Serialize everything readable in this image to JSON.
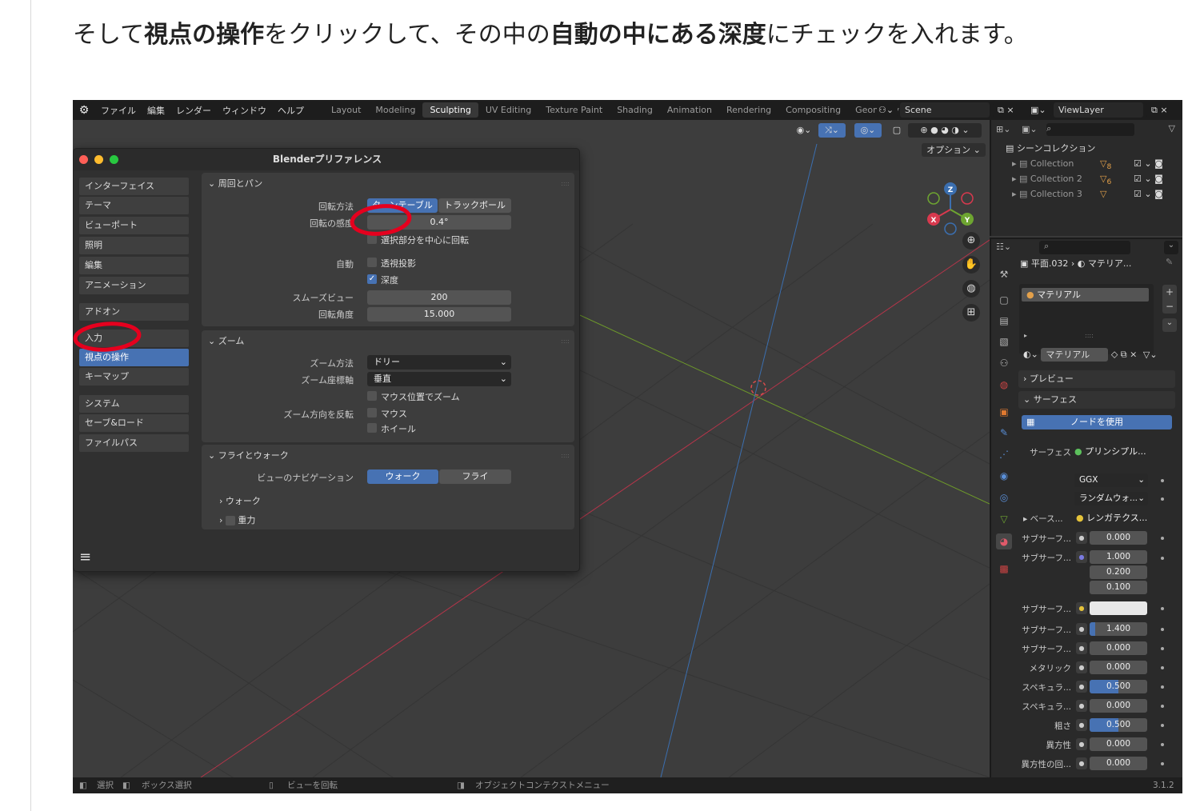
{
  "caption": {
    "segments": [
      {
        "text": "そして",
        "bold": false
      },
      {
        "text": "視点の操作",
        "bold": true
      },
      {
        "text": "をクリックして、その中の",
        "bold": false
      },
      {
        "text": "自動の中にある深度",
        "bold": true
      },
      {
        "text": "にチェックを入れます。",
        "bold": false
      }
    ]
  },
  "topbar": {
    "menus": [
      "ファイル",
      "編集",
      "レンダー",
      "ウィンドウ",
      "ヘルプ"
    ],
    "workspaces": [
      "Layout",
      "Modeling",
      "Sculpting",
      "UV Editing",
      "Texture Paint",
      "Shading",
      "Animation",
      "Rendering",
      "Compositing",
      "Geometry"
    ],
    "active_workspace": "Sculpting",
    "scene": "Scene",
    "view_layer": "ViewLayer"
  },
  "viewport": {
    "options_label": "オプション",
    "gizmo_axes": [
      "Z",
      "X",
      "Y"
    ],
    "colors": {
      "x_axis": "#b5354a",
      "y_axis": "#6e9a2a",
      "z_axis": "#3b6fb0",
      "highlight": "#e5001e"
    }
  },
  "preferences": {
    "title": "Blenderプリファレンス",
    "categories": [
      "インターフェイス",
      "テーマ",
      "ビューポート",
      "照明",
      "編集",
      "アニメーション",
      "アドオン",
      "入力",
      "視点の操作",
      "キーマップ",
      "システム",
      "セーブ&ロード",
      "ファイルパス"
    ],
    "active_category": "視点の操作",
    "orbit": {
      "header": "周回とパン",
      "rotation_method_label": "回転方法",
      "rotation_options": [
        "ターンテーブル",
        "トラックボール"
      ],
      "rotation_selected": "ターンテーブル",
      "sensitivity_label": "回転の感度",
      "sensitivity_value": "0.4°",
      "orbit_selection_label": "選択部分を中心に回転",
      "auto_label": "自動",
      "auto_perspective_label": "透視投影",
      "depth_label": "深度",
      "depth_checked": true,
      "smooth_view_label": "スムーズビュー",
      "smooth_view_value": "200",
      "rotation_angle_label": "回転角度",
      "rotation_angle_value": "15.000"
    },
    "zoom": {
      "header": "ズーム",
      "method_label": "ズーム方法",
      "method_value": "ドリー",
      "axis_label": "ズーム座標軸",
      "axis_value": "垂直",
      "zoom_to_mouse_label": "マウス位置でズーム",
      "invert_label": "ズーム方向を反転",
      "invert_mouse_label": "マウス",
      "invert_wheel_label": "ホイール"
    },
    "fly_walk": {
      "header": "フライとウォーク",
      "nav_label": "ビューのナビゲーション",
      "nav_options": [
        "ウォーク",
        "フライ"
      ],
      "nav_selected": "ウォーク",
      "walk_label": "ウォーク",
      "gravity_label": "重力"
    },
    "hamburger_icon": "hamburger-menu-icon"
  },
  "outliner": {
    "root_label": "シーンコレクション",
    "collections": [
      {
        "name": "Collection",
        "badge": "8"
      },
      {
        "name": "Collection 2",
        "badge": "6"
      },
      {
        "name": "Collection 3",
        "badge": ""
      }
    ]
  },
  "properties": {
    "breadcrumb_object": "平面.032",
    "breadcrumb_material": "マテリア...",
    "slot_name": "マテリアル",
    "material_name": "マテリアル",
    "preview_label": "プレビュー",
    "surface_section_label": "サーフェス",
    "use_nodes_label": "ノードを使用",
    "surface_label": "サーフェス",
    "surface_value": "プリンシプル...",
    "distribution_value": "GGX",
    "subsurface_method_value": "ランダムウォ...",
    "base_label": "ベース...",
    "base_value": "レンガテクス...",
    "rows": [
      {
        "label": "サブサーフ...",
        "value": "0.000",
        "fill": 0
      },
      {
        "label": "サブサーフ...",
        "values": [
          "1.000",
          "0.200",
          "0.100"
        ],
        "fill": 0
      },
      {
        "label": "サブサーフ...",
        "value": "",
        "fill": 0
      },
      {
        "label": "サブサーフ...",
        "value": "1.400",
        "fill": 0.1
      },
      {
        "label": "サブサーフ...",
        "value": "0.000",
        "fill": 0
      },
      {
        "label": "メタリック",
        "value": "0.000",
        "fill": 0
      },
      {
        "label": "スペキュラ...",
        "value": "0.500",
        "fill": 0.5
      },
      {
        "label": "スペキュラ...",
        "value": "0.000",
        "fill": 0
      },
      {
        "label": "粗さ",
        "value": "0.500",
        "fill": 0.5
      },
      {
        "label": "異方性",
        "value": "0.000",
        "fill": 0
      },
      {
        "label": "異方性の回...",
        "value": "0.000",
        "fill": 0
      }
    ]
  },
  "status_bar": {
    "select_label": "選択",
    "box_select_label": "ボックス選択",
    "rotate_view_label": "ビューを回転",
    "context_menu_label": "オブジェクトコンテクストメニュー",
    "version": "3.1.2"
  }
}
